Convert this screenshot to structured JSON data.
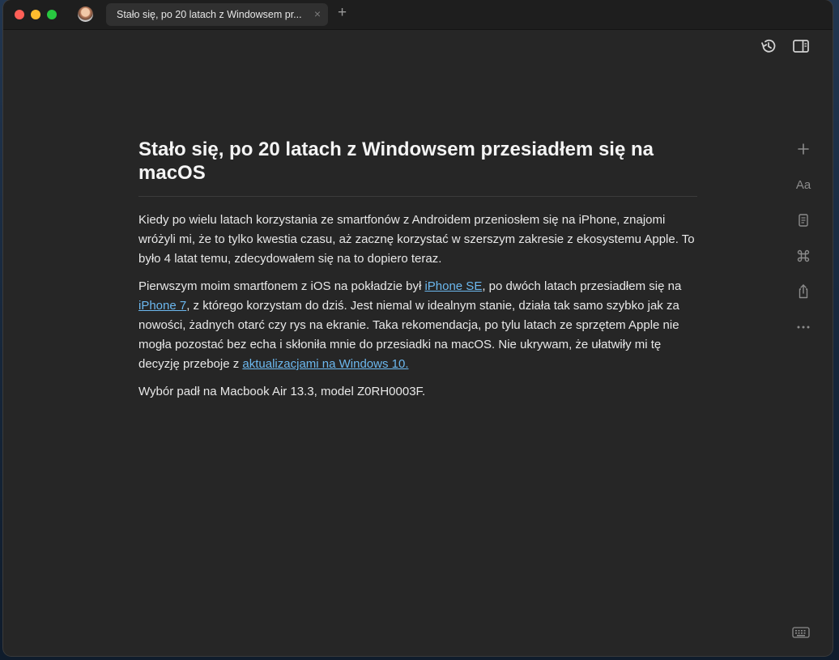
{
  "tab": {
    "title": "Stało się, po 20 latach z Windowsem pr...",
    "close_label": "×",
    "new_tab_label": "+"
  },
  "icons": {
    "history": "history-icon",
    "sidebar_toggle": "sidebar-toggle-icon",
    "add": "plus-icon",
    "typography": "text-format-icon",
    "reader": "reader-icon",
    "command": "command-icon",
    "share": "share-icon",
    "more": "more-icon",
    "keyboard": "keyboard-icon"
  },
  "toolbar": {
    "typography_label": "Aa"
  },
  "article": {
    "title": "Stało się, po 20 latach z Windowsem przesiadłem się na macOS",
    "p1": "Kiedy po wielu latach korzystania ze smartfonów z Androidem przeniosłem się na iPhone, znajomi wróżyli mi, że to tylko kwestia czasu, aż zacznę korzystać w szerszym zakresie z ekosystemu Apple. To było 4 latat temu, zdecydowałem się na to dopiero teraz.",
    "p2_part1": "Pierwszym moim smartfonem z iOS na pokładzie był ",
    "p2_link1": "iPhone SE",
    "p2_part2": ", po dwóch latach przesiadłem się na ",
    "p2_link2": "iPhone 7",
    "p2_part3": ", z którego korzystam do dziś. Jest niemal w idealnym stanie, działa tak samo szybko jak za nowości, żadnych otarć czy rys na ekranie. Taka rekomendacja, po tylu latach ze sprzętem Apple nie mogła pozostać bez echa i skłoniła mnie do przesiadki na macOS. Nie ukrywam, że ułatwiły mi tę decyzję przeboje z ",
    "p2_link3": "aktualizacjami na Windows 10.",
    "p3": "Wybór padł na Macbook Air 13.3, model Z0RH0003F."
  },
  "colors": {
    "link": "#6cb8ef",
    "background": "#262626",
    "text": "#e8e8e8"
  }
}
